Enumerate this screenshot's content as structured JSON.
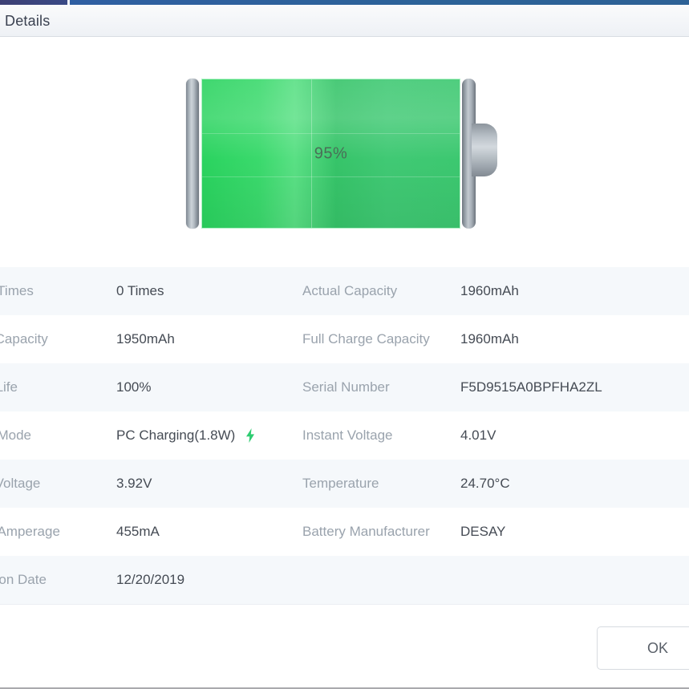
{
  "window": {
    "tab_label": "Details",
    "accent_color": "#2f5fa2",
    "accent_left_color": "#3c3f74"
  },
  "battery": {
    "percent_label": "95%",
    "percent_value": 95,
    "fill_color": "#3ad96c",
    "bolt_color": "#2ecc71"
  },
  "rows": [
    {
      "left_label": "Charge Times",
      "left_value": "0 Times",
      "right_label": "Actual Capacity",
      "right_value": "1960mAh",
      "charging": false
    },
    {
      "left_label": "Design Capacity",
      "left_value": "1950mAh",
      "right_label": "Full Charge Capacity",
      "right_value": "1960mAh",
      "charging": false
    },
    {
      "left_label": "Battery Life",
      "left_value": "100%",
      "right_label": "Serial Number",
      "right_value": "F5D9515A0BPFHA2ZL",
      "charging": false
    },
    {
      "left_label": "Charge Mode",
      "left_value": "PC Charging(1.8W)",
      "right_label": "Instant Voltage",
      "right_value": "4.01V",
      "charging": true
    },
    {
      "left_label": "Design Voltage",
      "left_value": "3.92V",
      "right_label": "Temperature",
      "right_value": "24.70°C",
      "charging": false
    },
    {
      "left_label": "Current Amperage",
      "left_value": "455mA",
      "right_label": "Battery Manufacturer",
      "right_value": "DESAY",
      "charging": false
    },
    {
      "left_label": "Production Date",
      "left_value": "12/20/2019",
      "right_label": "",
      "right_value": "",
      "charging": false
    }
  ],
  "footer": {
    "ok_label": "OK"
  }
}
